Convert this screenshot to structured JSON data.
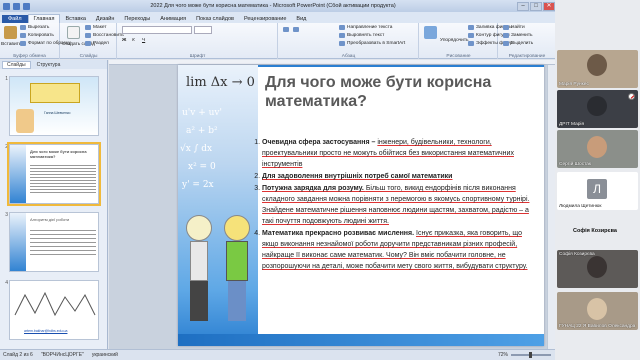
{
  "window": {
    "title": "2022 Для чого може бути корисна математика - Microsoft PowerPoint (Сбой активации продукта)",
    "buttons": {
      "minimize": "–",
      "maximize": "□",
      "close": "✕"
    }
  },
  "tabs": [
    "Файл",
    "Главная",
    "Вставка",
    "Дизайн",
    "Переходы",
    "Анимация",
    "Показ слайдов",
    "Рецензирование",
    "Вид"
  ],
  "ribbon": {
    "clipboard": {
      "paste": "Вставить",
      "cut": "Вырезать",
      "copy": "Копировать",
      "format": "Формат по образцу",
      "label": "Буфер обмена"
    },
    "slides": {
      "new": "Создать слайд",
      "layout": "Макет",
      "reset": "Восстановить",
      "section": "Раздел",
      "label": "Слайды"
    },
    "font": {
      "label": "Шрифт"
    },
    "paragraph": {
      "direction": "Направление текста",
      "align": "Выровнять текст",
      "smartart": "Преобразовать в SmartArt",
      "label": "Абзац"
    },
    "drawing": {
      "arrange": "Упорядочить",
      "styles": "Экспресс-стили",
      "fill": "Заливка фигуры",
      "outline": "Контур фигуры",
      "effects": "Эффекты фигур",
      "label": "Рисование"
    },
    "editing": {
      "find": "Найти",
      "replace": "Заменить",
      "select": "Выделить",
      "label": "Редактирование"
    }
  },
  "pane": {
    "tab_slides": "Слайды",
    "tab_outline": "Структура"
  },
  "thumbs": [
    {
      "num": "1",
      "text": "Ганна Шевченко"
    },
    {
      "num": "2",
      "text": "Для чого може бути корисна математика?"
    },
    {
      "num": "3",
      "text": "Алгоритм дієї роботи"
    },
    {
      "num": "4",
      "text": "artem.bakhar@hdbs.edu.ua"
    }
  ],
  "slide": {
    "title": "Для чого може бути корисна математика?",
    "formula": "lim Δx → 0",
    "items": [
      {
        "lead": "Очевидна сфера застосування – ",
        "text": "інженери, будівельники, технологи, проектувальники просто не можуть обійтися без використання математичних інструментів"
      },
      {
        "lead": "Для задоволення внутрішніх потреб самої математики",
        "text": ""
      },
      {
        "lead": "Потужна зарядка для розуму. ",
        "text": "Більш того, викид ендорфінів після виконання складного завдання можна порівняти з перемогою в якомусь спортивному турнірі. Знайдене математичне рішення наповнює людини щастям, захватом, радістю – а такі почуття подовжують людині життя."
      },
      {
        "lead": "Математика прекрасно розвиває мислення. ",
        "text": "Існує приказка, яка говорить, що якщо виконання незнайомої роботи доручити представникам різних професій, найкраще її виконає саме математик. Чому? Він вміє побачити головне, не розпорошуючи на деталі, може побачити мету свого життя, вибудувати структуру."
      }
    ]
  },
  "status": {
    "slide": "Слайд 2 из 6",
    "theme": "\"ВОРЧИнсЦОРГЕ\"",
    "lang": "украинский",
    "zoom": "72%"
  },
  "meet": {
    "participants": [
      {
        "name": "Марія Рункес",
        "kind": "video",
        "color": "#b7a690"
      },
      {
        "name": "ДРІТ Марія",
        "kind": "video",
        "color": "#3c3f46"
      },
      {
        "name": "Сергій Шостак",
        "kind": "video",
        "color": "#8b8f8a"
      },
      {
        "name": "Людмила Щетинюк",
        "kind": "letter",
        "letter": "Л"
      },
      {
        "name": "Софія Козирєва",
        "kind": "plain"
      },
      {
        "name": "Софія Козирєва",
        "kind": "video",
        "color": "#5d5a58"
      },
      {
        "name": "ГУНАЦ 22 Я Вавилов Олександра",
        "kind": "video",
        "color": "#a89a88"
      }
    ]
  },
  "colors": {
    "accent": "#2b7fd1",
    "tab_file": "#2a5aa8"
  }
}
